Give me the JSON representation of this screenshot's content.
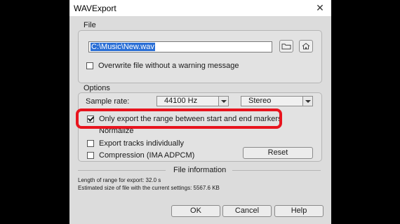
{
  "window": {
    "title": "WAVExport"
  },
  "file_section": {
    "label": "File",
    "path_value": "C:\\Music\\New.wav",
    "browse_icon": "folder-icon",
    "home_icon": "home-icon",
    "overwrite_label": "Overwrite file without a warning message",
    "overwrite_checked": false
  },
  "options_section": {
    "label": "Options",
    "sample_rate_label": "Sample rate:",
    "sample_rate_value": "44100 Hz",
    "channels_value": "Stereo",
    "export_range_label": "Only export the range between start and end markers",
    "export_range_checked": true,
    "normalize_label": "Normalize",
    "export_tracks_label": "Export tracks individually",
    "compression_label": "Compression (IMA ADPCM)",
    "reset_label": "Reset"
  },
  "file_info": {
    "heading": "File information",
    "length_text": "Length of range for export: 32.0 s",
    "size_text": "Estimated size of file with the current settings: 5567.6 KB"
  },
  "buttons": {
    "ok": "OK",
    "cancel": "Cancel",
    "help": "Help"
  },
  "colors": {
    "highlight": "#e8141e",
    "selection": "#2b6fd6",
    "dialog_bg": "#dcdcdc"
  }
}
